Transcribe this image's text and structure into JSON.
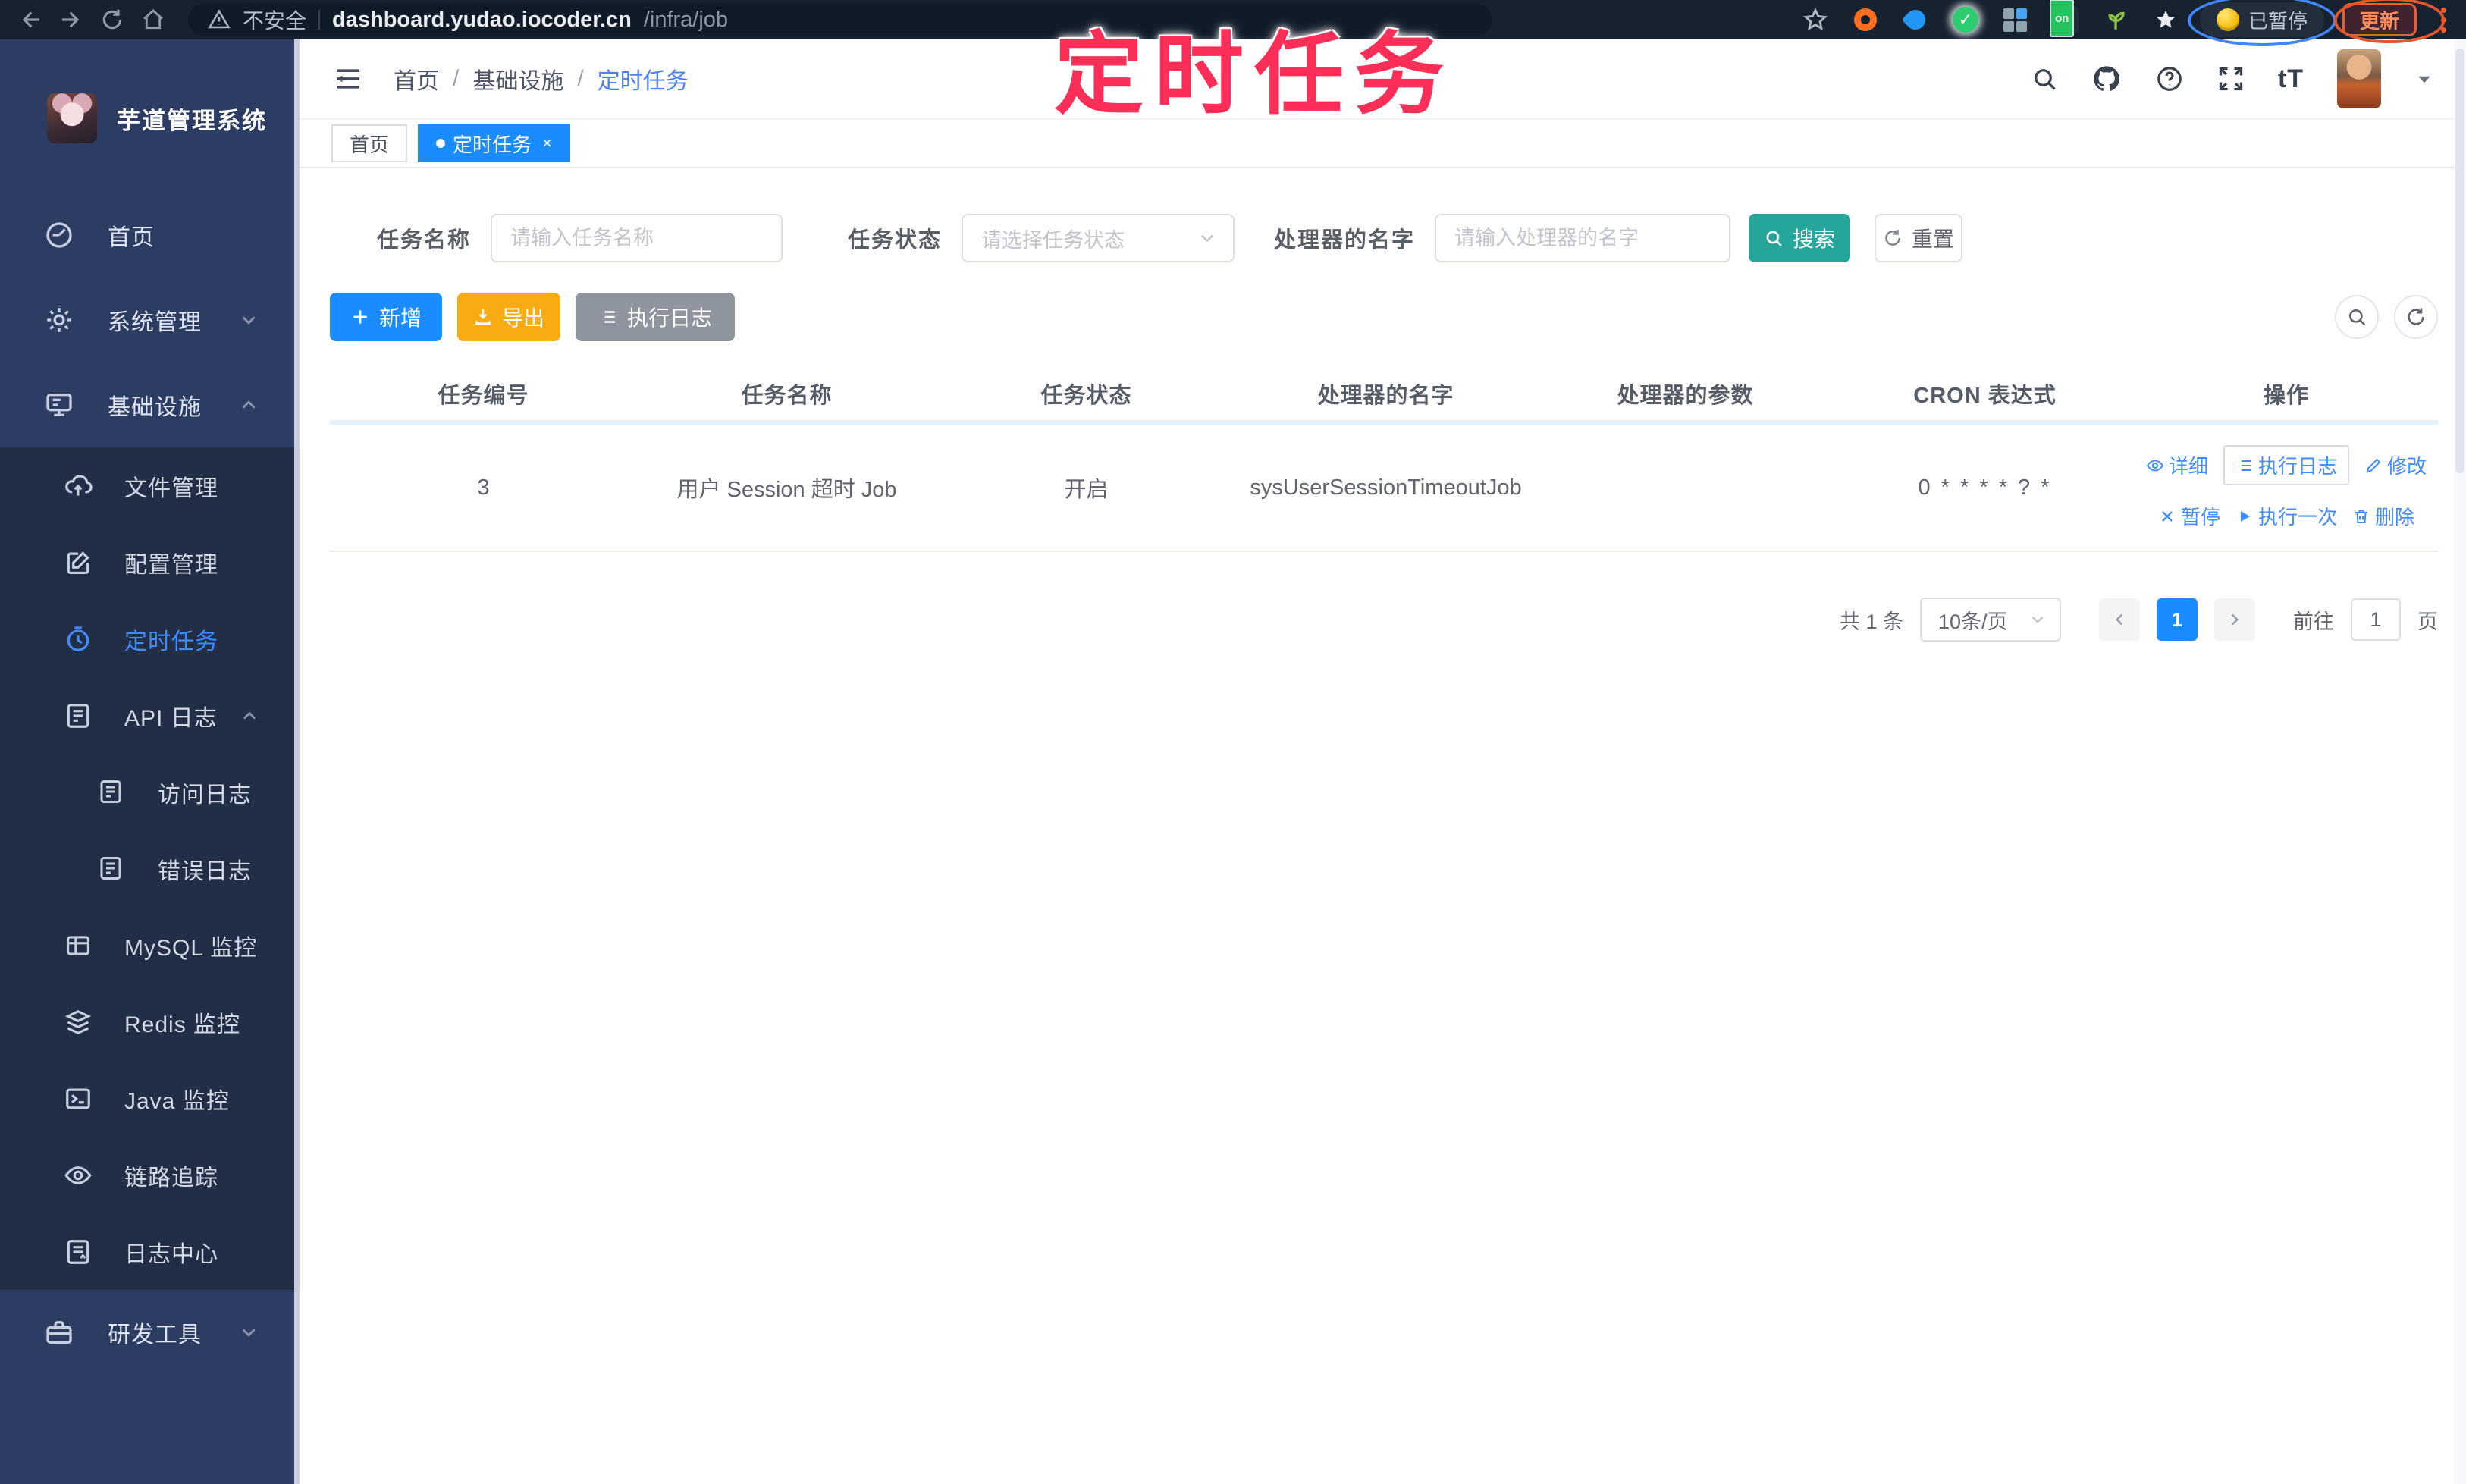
{
  "browser": {
    "security_warning": "不安全",
    "url_host": "dashboard.yudao.iocoder.cn",
    "url_path": "/infra/job",
    "paused_badge": "已暂停",
    "update_button": "更新",
    "on_badge": "on"
  },
  "overlay": {
    "annotation_text": "定时任务"
  },
  "sidebar": {
    "app_title": "芋道管理系统",
    "items": [
      {
        "label": "首页",
        "icon": "dashboard-icon"
      },
      {
        "label": "系统管理",
        "icon": "gear-icon",
        "chevron": "down"
      },
      {
        "label": "基础设施",
        "icon": "monitor-icon",
        "chevron": "up"
      },
      {
        "label": "研发工具",
        "icon": "toolbox-icon",
        "chevron": "down"
      }
    ],
    "submenu": [
      {
        "label": "文件管理",
        "icon": "cloud-upload-icon"
      },
      {
        "label": "配置管理",
        "icon": "edit-square-icon"
      },
      {
        "label": "定时任务",
        "icon": "timer-icon",
        "active": true
      },
      {
        "label": "API 日志",
        "icon": "log-icon",
        "chevron": "up"
      },
      {
        "label": "访问日志",
        "icon": "log-icon",
        "level": 2
      },
      {
        "label": "错误日志",
        "icon": "log-icon",
        "level": 2
      },
      {
        "label": "MySQL 监控",
        "icon": "database-icon"
      },
      {
        "label": "Redis 监控",
        "icon": "layers-icon"
      },
      {
        "label": "Java 监控",
        "icon": "terminal-icon"
      },
      {
        "label": "链路追踪",
        "icon": "eye-icon"
      },
      {
        "label": "日志中心",
        "icon": "log-icon"
      }
    ]
  },
  "header": {
    "breadcrumb": [
      "首页",
      "基础设施",
      "定时任务"
    ],
    "separator": "/",
    "font_size_tool": "tT"
  },
  "tags": [
    {
      "label": "首页",
      "active": false
    },
    {
      "label": "定时任务",
      "active": true,
      "close": "×"
    }
  ],
  "filters": {
    "name_label": "任务名称",
    "name_placeholder": "请输入任务名称",
    "status_label": "任务状态",
    "status_placeholder": "请选择任务状态",
    "handler_label": "处理器的名字",
    "handler_placeholder": "请输入处理器的名字",
    "search_label": "搜索",
    "reset_label": "重置"
  },
  "toolbar": {
    "add_label": "新增",
    "export_label": "导出",
    "log_label": "执行日志"
  },
  "table": {
    "columns": [
      "任务编号",
      "任务名称",
      "任务状态",
      "处理器的名字",
      "处理器的参数",
      "CRON 表达式",
      "操作"
    ],
    "rows": [
      {
        "id": "3",
        "name": "用户 Session 超时 Job",
        "status": "开启",
        "handler": "sysUserSessionTimeoutJob",
        "param": "",
        "cron": "0 * * * * ? *",
        "actions": [
          "详细",
          "执行日志",
          "修改",
          "暂停",
          "执行一次",
          "删除"
        ]
      }
    ]
  },
  "pagination": {
    "total": "共 1 条",
    "page_size": "10条/页",
    "current_page": "1",
    "goto_label": "前往",
    "goto_value": "1",
    "page_unit": "页"
  },
  "colors": {
    "chrome_bg": "#172231",
    "sidebar_bg": "#2d3c63",
    "submenu_bg": "#212e45",
    "accent_blue": "#1a8cff",
    "link_blue": "#3f8cff",
    "search_teal": "#26a69a",
    "export_amber": "#f9ab14",
    "info_gray": "#8f959e",
    "overlay_pink": "#fb2e58"
  }
}
